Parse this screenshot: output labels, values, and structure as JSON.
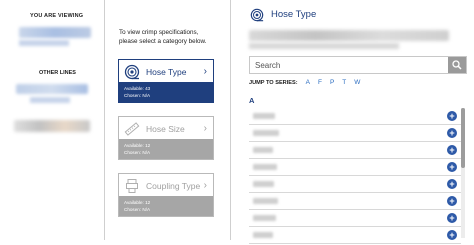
{
  "left": {
    "viewing_title": "YOU ARE VIEWING",
    "other_title": "OTHER LINES"
  },
  "middle": {
    "instruction_line1": "To view crimp specifications,",
    "instruction_line2": "please select a category below.",
    "cards": [
      {
        "name": "Hose Type",
        "available": "Available: 43",
        "chosen": "Chosen: N/A",
        "state": "active",
        "icon": "hose-icon"
      },
      {
        "name": "Hose Size",
        "available": "Available: 12",
        "chosen": "Chosen: N/A",
        "state": "disabled",
        "icon": "ruler-icon"
      },
      {
        "name": "Coupling Type",
        "available": "Available: 12",
        "chosen": "Chosen: N/A",
        "state": "disabled",
        "icon": "coupling-icon"
      }
    ],
    "chevron": "›"
  },
  "right": {
    "title": "Hose Type",
    "search_placeholder": "Search",
    "jump_label": "JUMP TO SERIES:",
    "jump_letters": [
      "A",
      "F",
      "P",
      "T",
      "W"
    ],
    "section_letter": "A",
    "add_glyph": "+"
  },
  "colors": {
    "brand_blue": "#1f3f7e",
    "link_blue": "#2a6cc0",
    "disabled_gray": "#a6a6a6"
  }
}
